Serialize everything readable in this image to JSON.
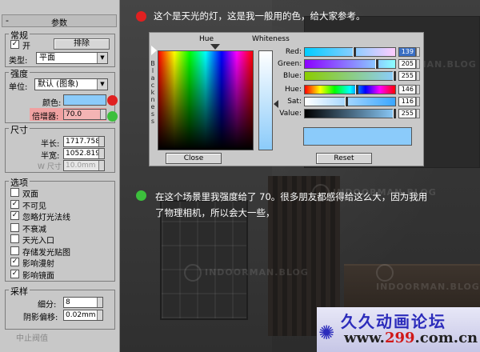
{
  "rollout": {
    "minus": "-",
    "title": "参数",
    "general": {
      "label": "常规",
      "on_label": "开",
      "on_checked": true,
      "exclude_btn": "排除",
      "type_label": "类型:",
      "type_value": "平面"
    },
    "intensity": {
      "label": "强度",
      "units_label": "单位:",
      "units_value": "默认 (图象)",
      "color_label": "颜色:",
      "color": "#8bcbfa",
      "multiplier_label": "倍增器:",
      "multiplier_value": "70.0"
    },
    "size": {
      "label": "尺寸",
      "half_length_label": "半长:",
      "half_length_value": "1717.758",
      "half_width_label": "半宽:",
      "half_width_value": "1052.819",
      "w_size_label": "W 尺寸",
      "w_size_value": "10.0mm"
    },
    "options": {
      "label": "选项",
      "items": [
        {
          "label": "双面",
          "checked": false
        },
        {
          "label": "不可见",
          "checked": true
        },
        {
          "label": "忽略灯光法线",
          "checked": true
        },
        {
          "label": "不衰减",
          "checked": false
        },
        {
          "label": "天光入口",
          "checked": false
        },
        {
          "label": "存储发光贴图",
          "checked": false
        },
        {
          "label": "影响漫射",
          "checked": true
        },
        {
          "label": "影响镜面",
          "checked": true
        }
      ]
    },
    "sampling": {
      "label": "采样",
      "subdivs_label": "细分:",
      "subdivs_value": "8",
      "shadow_bias_label": "阴影偏移:",
      "shadow_bias_value": "0.02mm",
      "cut_label": "中止阀值"
    }
  },
  "color_selector": {
    "hue_label": "Hue",
    "whiteness_label": "Whiteness",
    "blackness_label": "Blackness",
    "rgb": [
      {
        "label": "Red:",
        "value": "139",
        "selected": true
      },
      {
        "label": "Green:",
        "value": "205",
        "selected": false
      },
      {
        "label": "Blue:",
        "value": "255",
        "selected": false
      }
    ],
    "hsv": [
      {
        "label": "Hue:",
        "value": "146"
      },
      {
        "label": "Sat:",
        "value": "116"
      },
      {
        "label": "Value:",
        "value": "255"
      }
    ],
    "preview_color": "#8bcbfa",
    "close_btn": "Close",
    "reset_btn": "Reset"
  },
  "notes": {
    "note1": "这个是天光的灯，这是我一般用的色，给大家参考。",
    "note1_dot_color": "#e02020",
    "note2_line1": "在这个场景里我强度给了 70。很多朋友都感得给这么大，因为我用",
    "note2_line2": "了物理相机，所以会大一些，",
    "note2_dot_color": "#3cbf3c"
  },
  "logo": {
    "title": "久久动画论坛",
    "url_prefix": "www.",
    "url_number": "299",
    "url_suffix": ".com.cn"
  },
  "watermarks": [
    "INDOORMAN.BLOG"
  ]
}
